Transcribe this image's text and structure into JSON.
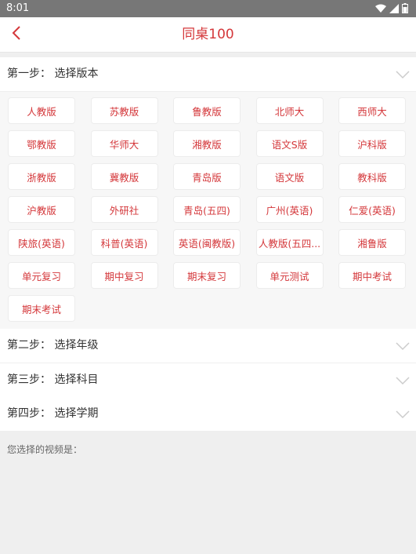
{
  "status_bar": {
    "time": "8:01",
    "icons": [
      "wifi-icon",
      "cellular-signal-icon",
      "battery-icon"
    ]
  },
  "header": {
    "title": "同桌100",
    "back_icon": "chevron-left-icon",
    "accent_color": "#d4373a"
  },
  "steps": [
    {
      "label": "第一步：  选择版本",
      "expanded": true
    },
    {
      "label": "第二步：  选择年级",
      "expanded": false
    },
    {
      "label": "第三步：  选择科目",
      "expanded": false
    },
    {
      "label": "第四步：  选择学期",
      "expanded": false
    }
  ],
  "editions": [
    "人教版",
    "苏教版",
    "鲁教版",
    "北师大",
    "西师大",
    "鄂教版",
    "华师大",
    "湘教版",
    "语文S版",
    "沪科版",
    "浙教版",
    "冀教版",
    "青岛版",
    "语文版",
    "教科版",
    "沪教版",
    "外研社",
    "青岛(五四)",
    "广州(英语)",
    "仁爱(英语)",
    "陕旅(英语)",
    "科普(英语)",
    "英语(闽教版)",
    "人教版(五四...",
    "湘鲁版",
    "单元复习",
    "期中复习",
    "期末复习",
    "单元测试",
    "期中考试",
    "期末考试"
  ],
  "result": {
    "label": "您选择的视频是："
  }
}
